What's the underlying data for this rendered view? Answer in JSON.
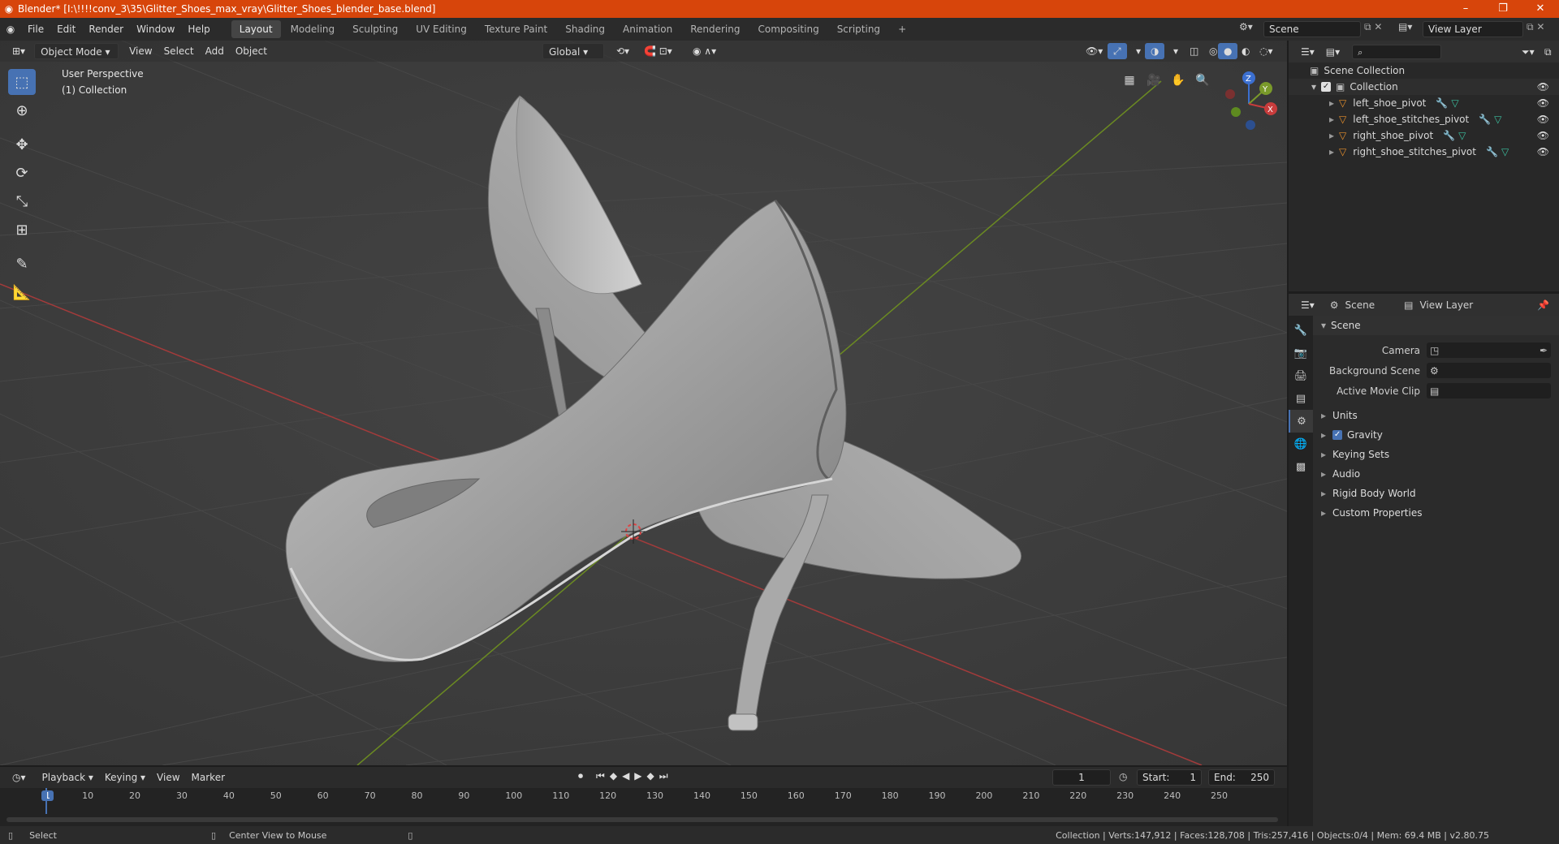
{
  "title": "Blender* [I:\\!!!!conv_3\\35\\Glitter_Shoes_max_vray\\Glitter_Shoes_blender_base.blend]",
  "window_controls": {
    "minimize": "–",
    "maximize": "❐",
    "close": "✕"
  },
  "menus": [
    "File",
    "Edit",
    "Render",
    "Window",
    "Help"
  ],
  "workspaces": [
    "Layout",
    "Modeling",
    "Sculpting",
    "UV Editing",
    "Texture Paint",
    "Shading",
    "Animation",
    "Rendering",
    "Compositing",
    "Scripting"
  ],
  "active_workspace": "Layout",
  "scene_field": "Scene",
  "view_layer_field": "View Layer",
  "viewport": {
    "mode": "Object Mode",
    "menus": [
      "View",
      "Select",
      "Add",
      "Object"
    ],
    "transform": "Global",
    "overlay_text_1": "User Perspective",
    "overlay_text_2": "(1) Collection",
    "gizmo_axes": [
      "X",
      "Y",
      "Z"
    ]
  },
  "outliner": {
    "root": "Scene Collection",
    "collection": "Collection",
    "items": [
      "left_shoe_pivot",
      "left_shoe_stitches_pivot",
      "right_shoe_pivot",
      "right_shoe_stitches_pivot"
    ]
  },
  "properties": {
    "tab_scene": "Scene",
    "tab_view_layer": "View Layer",
    "section": "Scene",
    "fields": [
      {
        "label": "Camera",
        "value": ""
      },
      {
        "label": "Background Scene",
        "value": ""
      },
      {
        "label": "Active Movie Clip",
        "value": ""
      }
    ],
    "subsections": [
      "Units",
      "Gravity",
      "Keying Sets",
      "Audio",
      "Rigid Body World",
      "Custom Properties"
    ],
    "gravity_checked": true
  },
  "timeline": {
    "menus": [
      "Playback",
      "Keying",
      "View",
      "Marker"
    ],
    "current_frame": "1",
    "start_label": "Start:",
    "start": "1",
    "end_label": "End:",
    "end": "250",
    "ticks": [
      "1",
      "10",
      "20",
      "30",
      "40",
      "50",
      "60",
      "70",
      "80",
      "90",
      "100",
      "110",
      "120",
      "130",
      "140",
      "150",
      "160",
      "170",
      "180",
      "190",
      "200",
      "210",
      "220",
      "230",
      "240",
      "250"
    ]
  },
  "status": {
    "left_action": "Select",
    "middle_action": "Center View to Mouse",
    "stats": "Collection | Verts:147,912 | Faces:128,708 | Tris:257,416 | Objects:0/4 | Mem: 69.4 MB | v2.80.75"
  },
  "colors": {
    "accent": "#4772b3",
    "title_bar": "#d7450b",
    "x_axis": "#c83c3c",
    "y_axis": "#7a9a2a",
    "z_axis": "#3b6fd0"
  }
}
